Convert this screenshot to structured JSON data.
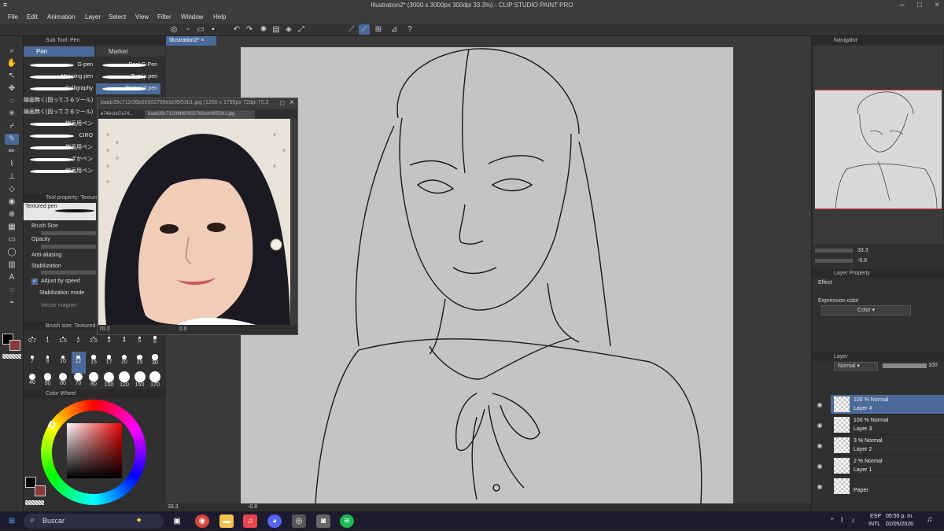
{
  "app": {
    "window_title": "Illustration2* (3000 x 3000px 300dpi 33.3%)  - CLIP STUDIO PAINT PRO"
  },
  "menu": [
    "File",
    "Edit",
    "Animation",
    "Layer",
    "Select",
    "View",
    "Filter",
    "Window",
    "Help"
  ],
  "left": {
    "subtool_header": "Sub Tool: Pen",
    "tabs": [
      "Pen",
      "Marker"
    ],
    "brushes_left": [
      "G-pen",
      "Mapping pen",
      "Calligraphy",
      "線画無く(固ってさるツール)",
      "線画無く(固ってさるツール)",
      "線画用ペン",
      "CIRO",
      "線画用ペン",
      "ざかペン",
      "線画用ペン"
    ],
    "brushes_right": [
      "Real G-Pen",
      "Turnip pen",
      "Textured pen"
    ],
    "tool_property_header": "Tool property: Textured",
    "tool_name": "Textured pen",
    "props": [
      "Brush Size",
      "Opacity",
      "Anti-aliasing",
      "Stabilization",
      "Adjust by speed",
      "Stabilization mode",
      "Vector magnet"
    ],
    "brush_size_header": "Brush size: Textured pen",
    "brush_sizes": [
      "0.7",
      "1",
      "1.5",
      "2",
      "2.5",
      "3",
      "4",
      "5",
      "6",
      "7",
      "8",
      "10",
      "12",
      "15",
      "17",
      "20",
      "25",
      "30",
      "40",
      "50",
      "60",
      "70",
      "80",
      "100",
      "120",
      "150",
      "170"
    ],
    "selected_size": "12",
    "color_wheel_header": "Color Wheel"
  },
  "reference_window": {
    "title": "baab39c711f36b60902766edcf6f53b1.jpg (1200 x 1799px 72dpi 70.2%)",
    "tabs": [
      "e74bcbd7a74...",
      "baab39c711f36b60902766edcf6f53b1.jpg"
    ],
    "zoom": "70.2",
    "angle": "0.0"
  },
  "workspace": {
    "doc_tab": "Illustration2*",
    "zoom": "33.3",
    "angle": "-0.8"
  },
  "navigator": {
    "header": "Navigator",
    "zoom": "33.3",
    "angle": "-0.8"
  },
  "layer_property": {
    "header": "Layer Property",
    "effect_label": "Effect",
    "expression_color_label": "Expression color",
    "expression_color_value": "Color"
  },
  "layers": {
    "header": "Layer",
    "blend_mode": "Normal",
    "opacity": "100",
    "items": [
      {
        "line1": "100 % Normal",
        "line2": "Layer 4",
        "selected": true
      },
      {
        "line1": "100 % Normal",
        "line2": "Layer 3",
        "selected": false
      },
      {
        "line1": "3 % Normal",
        "line2": "Layer 2",
        "selected": false
      },
      {
        "line1": "2 % Normal",
        "line2": "Layer 1",
        "selected": false
      },
      {
        "line1": "",
        "line2": "Paper",
        "selected": false
      }
    ]
  },
  "taskbar": {
    "search_placeholder": "Buscar",
    "lang1": "ESP",
    "lang2": "INTL",
    "time": "05:55 p. m.",
    "date": "02/05/2026"
  },
  "colors": {
    "accent": "#4b6a9a",
    "main_color": "#000000",
    "sub_color": "#8a3a3a",
    "canvas_bg": "#c4c4c4"
  }
}
